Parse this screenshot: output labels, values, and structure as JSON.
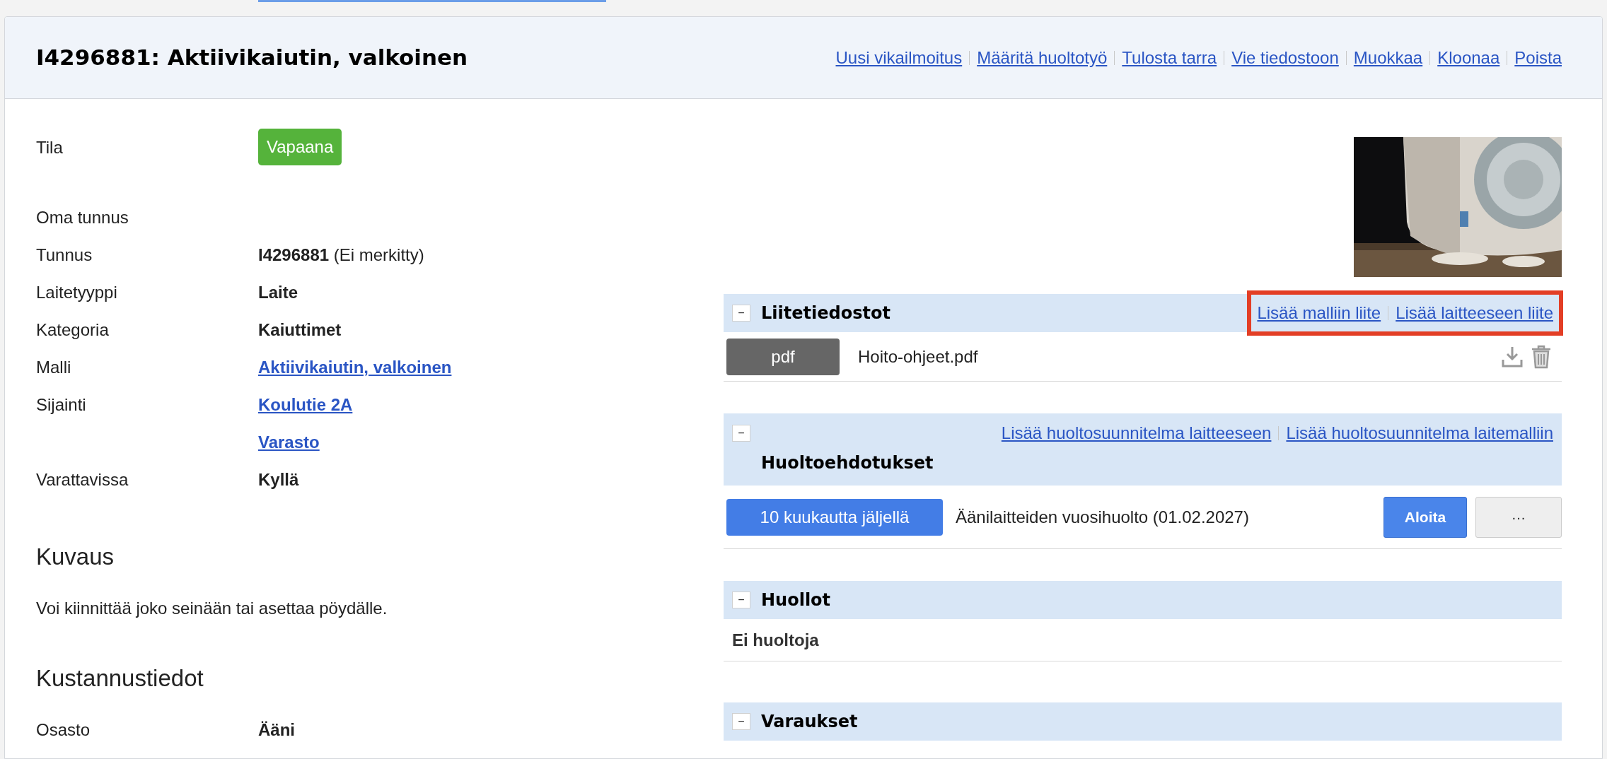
{
  "header": {
    "title": "I4296881: Aktiivikaiutin, valkoinen",
    "actions": [
      "Uusi vikailmoitus",
      "Määritä huoltotyö",
      "Tulosta tarra",
      "Vie tiedostoon",
      "Muokkaa",
      "Kloonaa",
      "Poista"
    ]
  },
  "details": [
    {
      "label": "Tila",
      "kind": "badge",
      "value": "Vapaana",
      "color": "#55b33b"
    },
    {
      "label": "Oma tunnus",
      "kind": "none"
    },
    {
      "label": "Tunnus",
      "kind": "rich",
      "value": "**I4296881** (Ei merkitty)"
    },
    {
      "label": "Laitetyyppi",
      "kind": "bold",
      "value": "Laite"
    },
    {
      "label": "Kategoria",
      "kind": "bold",
      "value": "Kaiuttimet"
    },
    {
      "label": "Malli",
      "kind": "links",
      "links": [
        "Aktiivikaiutin, valkoinen"
      ]
    },
    {
      "label": "Sijainti",
      "kind": "links",
      "links": [
        "Koulutie 2A",
        "Varasto"
      ]
    },
    {
      "label": "Varattavissa",
      "kind": "bold",
      "value": "Kyllä"
    }
  ],
  "description": {
    "title": "Kuvaus",
    "text": "Voi kiinnittää joko seinään tai asettaa pöydälle."
  },
  "costs": {
    "title": "Kustannustiedot",
    "rows": [
      {
        "label": "Osasto",
        "kind": "bold",
        "value": "Ääni"
      }
    ]
  },
  "sections": [
    {
      "kind": "inline",
      "toggle": "−",
      "title": "Liitetiedostot",
      "actions": [
        "Lisää malliin liite",
        "Lisää laitteeseen liite"
      ],
      "actions_highlighted": true,
      "files": [
        {
          "type": "pdf",
          "name": "Hoito-ohjeet.pdf"
        }
      ]
    },
    {
      "kind": "stacked",
      "toggle": "−",
      "title": "Huoltoehdotukset",
      "actions": [
        "Lisää huoltosuunnitelma laitteeseen",
        "Lisää huoltosuunnitelma laitemalliin"
      ],
      "actions_highlighted": false,
      "suggestions": [
        {
          "due": "10 kuukautta jäljellä",
          "name": "Äänilaitteiden vuosihuolto (01.02.2027)",
          "start": "Aloita",
          "more": "···"
        }
      ]
    },
    {
      "kind": "inline",
      "toggle": "−",
      "title": "Huollot",
      "empty_text": "Ei huoltoja"
    },
    {
      "kind": "inline",
      "toggle": "−",
      "title": "Varaukset"
    }
  ]
}
